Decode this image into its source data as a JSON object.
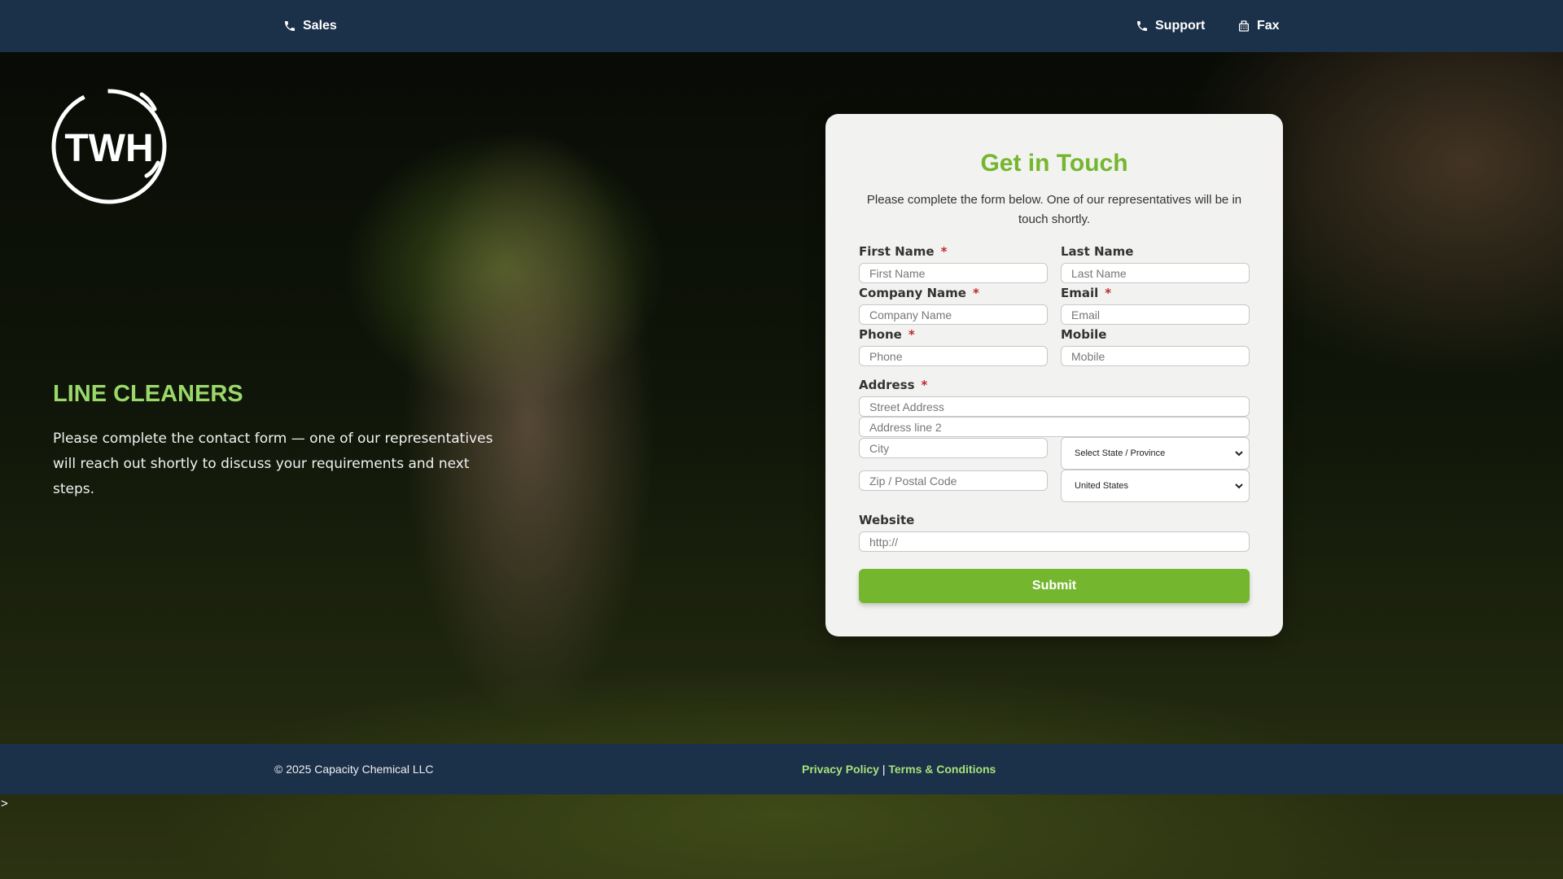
{
  "topbar": {
    "sales_label": "Sales",
    "support_label": "Support",
    "fax_label": "Fax"
  },
  "logo": {
    "text": "TWH"
  },
  "hero": {
    "title": "LINE CLEANERS",
    "text": "Please complete the contact form — one of our representatives will reach out shortly to discuss your requirements and next steps."
  },
  "form": {
    "title": "Get in Touch",
    "subtitle": "Please complete the form below. One of our representatives will be in touch shortly.",
    "required_mark": "*",
    "first_name": {
      "label": "First Name",
      "placeholder": "First Name"
    },
    "last_name": {
      "label": "Last Name",
      "placeholder": "Last Name"
    },
    "company": {
      "label": "Company Name",
      "placeholder": "Company Name"
    },
    "email": {
      "label": "Email",
      "placeholder": "Email"
    },
    "phone": {
      "label": "Phone",
      "placeholder": "Phone"
    },
    "mobile": {
      "label": "Mobile",
      "placeholder": "Mobile"
    },
    "address": {
      "label": "Address",
      "street_placeholder": "Street Address",
      "line2_placeholder": "Address line 2",
      "city_placeholder": "City",
      "state_value": "Select State / Province",
      "zip_placeholder": "Zip / Postal Code",
      "country_value": "United States"
    },
    "website": {
      "label": "Website",
      "placeholder": "http://"
    },
    "submit_label": "Submit"
  },
  "footer": {
    "copyright": "© 2025 Capacity Chemical LLC",
    "privacy_label": "Privacy Policy",
    "separator": "|",
    "terms_label": "Terms & Conditions"
  },
  "misc": {
    "caret": ">"
  },
  "colors": {
    "accent": "#74b72e",
    "hero_title": "#9bd86a",
    "topbar": "#1b3049",
    "required": "#c0282d"
  }
}
